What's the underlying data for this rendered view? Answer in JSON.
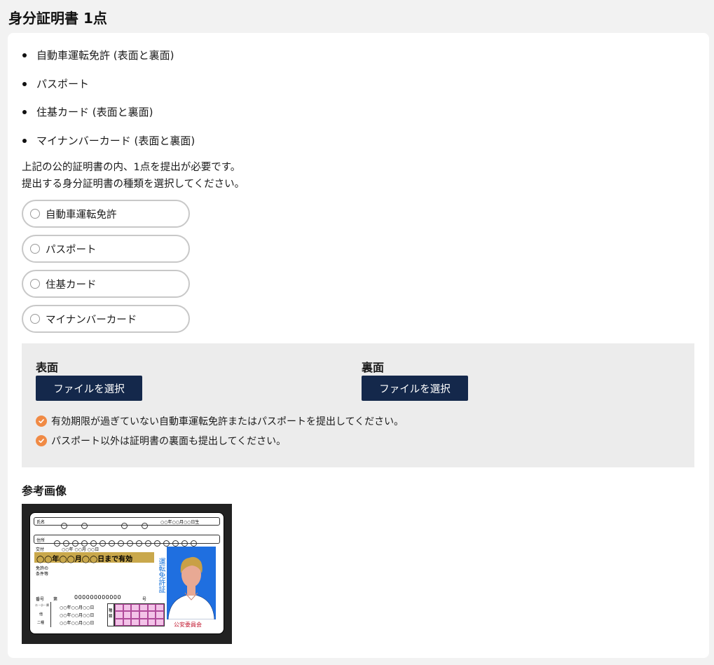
{
  "page": {
    "title": "身分証明書 1点"
  },
  "documents": [
    {
      "label": "自動車運転免許 (表面と裏面)"
    },
    {
      "label": "パスポート"
    },
    {
      "label": "住基カード (表面と裏面)"
    },
    {
      "label": "マイナンバーカード (表面と裏面)"
    }
  ],
  "instructions": {
    "line1": "上記の公的証明書の内、1点を提出が必要です。",
    "line2": "提出する身分証明書の種類を選択してください。"
  },
  "options": [
    {
      "label": "自動車運転免許",
      "selected": false
    },
    {
      "label": "パスポート",
      "selected": false
    },
    {
      "label": "住基カード",
      "selected": false
    },
    {
      "label": "マイナンバーカード",
      "selected": false
    }
  ],
  "upload": {
    "front_label": "表面",
    "back_label": "裏面",
    "front_button": "ファイルを選択",
    "back_button": "ファイルを選択",
    "notes": [
      "有効期限が過ぎていない自動車運転免許またはパスポートを提出してください。",
      "パスポート以外は証明書の裏面も提出してください。"
    ],
    "note_icon": "check-circle-icon",
    "accent_color": "#f08a45",
    "button_color": "#14284b"
  },
  "reference": {
    "title": "参考画像",
    "license": {
      "name_label": "氏名",
      "birth": "○○年○○月○○日生",
      "address_label": "住所",
      "issue_label": "交付",
      "issue_date": "○○年 ○○月 ○○日",
      "expiry": "◯◯年◯◯月◯◯日まで有効",
      "conditions_label": "免許の条件等",
      "number_label": "番号",
      "number_prefix": "第",
      "number": "000000000000",
      "number_suffix": "号",
      "dates": [
        "○○年○○月○○日",
        "○○年○○月○○日",
        "○○年○○月○○日"
      ],
      "left_labels": [
        "二・小・原",
        "他",
        "二種"
      ],
      "type_label": "種類",
      "vertical_title": "運転免許証",
      "authority": "公安委員会"
    }
  }
}
